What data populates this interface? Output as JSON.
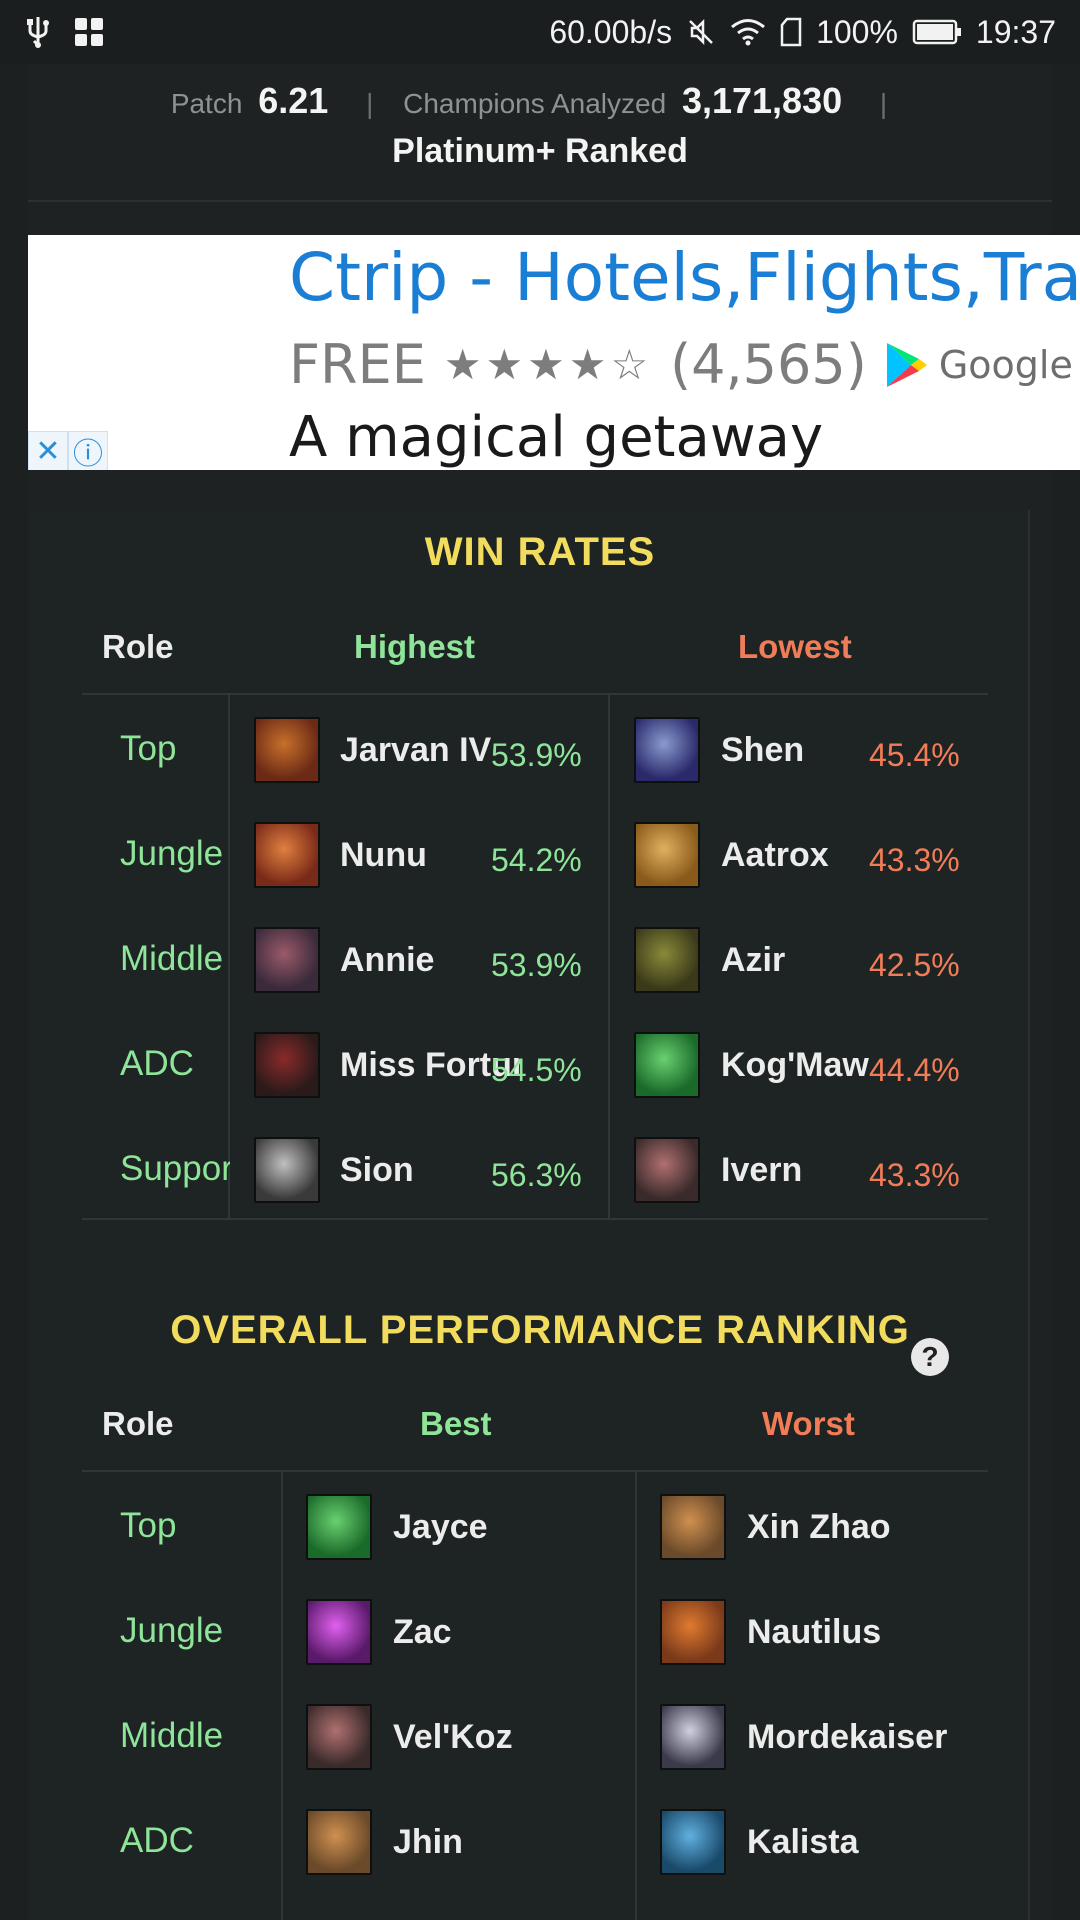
{
  "status_bar": {
    "speed": "60.00b/s",
    "battery": "100%",
    "time": "19:37"
  },
  "header": {
    "patch_label": "Patch",
    "patch_value": "6.21",
    "champions_label": "Champions Analyzed",
    "champions_value": "3,171,830",
    "tier": "Platinum+ Ranked"
  },
  "ad": {
    "title": "Ctrip - Hotels,Flights,Trains",
    "price": "FREE",
    "stars": "★★★★☆",
    "reviews": "(4,565)",
    "store": "Google Play",
    "tagline": "A magical getaway"
  },
  "win_rates": {
    "title": "WIN RATES",
    "col_role": "Role",
    "col_high": "Highest",
    "col_low": "Lowest",
    "rows": [
      {
        "role": "Top",
        "high_name": "Jarvan IV",
        "high_pct": "53.9%",
        "low_name": "Shen",
        "low_pct": "45.4%"
      },
      {
        "role": "Jungle",
        "high_name": "Nunu",
        "high_pct": "54.2%",
        "low_name": "Aatrox",
        "low_pct": "43.3%"
      },
      {
        "role": "Middle",
        "high_name": "Annie",
        "high_pct": "53.9%",
        "low_name": "Azir",
        "low_pct": "42.5%"
      },
      {
        "role": "ADC",
        "high_name": "Miss Fortune",
        "high_pct": "54.5%",
        "low_name": "Kog'Maw",
        "low_pct": "44.4%"
      },
      {
        "role": "Support",
        "high_name": "Sion",
        "high_pct": "56.3%",
        "low_name": "Ivern",
        "low_pct": "43.3%"
      }
    ]
  },
  "performance": {
    "title": "OVERALL PERFORMANCE RANKING",
    "help": "?",
    "col_role": "Role",
    "col_best": "Best",
    "col_worst": "Worst",
    "rows": [
      {
        "role": "Top",
        "best": "Jayce",
        "worst": "Xin Zhao"
      },
      {
        "role": "Jungle",
        "best": "Zac",
        "worst": "Nautilus"
      },
      {
        "role": "Middle",
        "best": "Vel'Koz",
        "worst": "Mordekaiser"
      },
      {
        "role": "ADC",
        "best": "Jhin",
        "worst": "Kalista"
      }
    ]
  },
  "colors": {
    "accent_title": "#f2dc5d",
    "good": "#8ee59a",
    "bad": "#f07d58"
  }
}
